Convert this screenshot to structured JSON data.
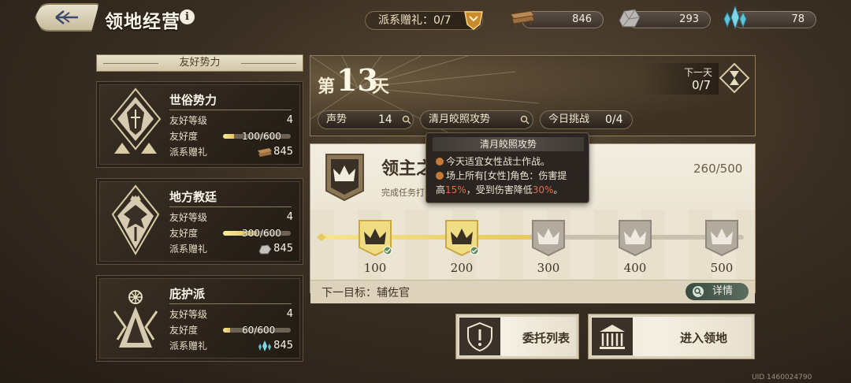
{
  "header": {
    "title": "领地经营",
    "gift_label": "派系赠礼：0/7",
    "resources": [
      {
        "name": "wood-plank",
        "value": "846"
      },
      {
        "name": "stone-ore",
        "value": "293"
      },
      {
        "name": "blue-crystal",
        "value": "78"
      }
    ]
  },
  "left_panel": {
    "section_title": "友好势力",
    "factions": [
      {
        "name": "世俗势力",
        "level_label": "友好等级",
        "level": "4",
        "fav_label": "友好度",
        "fav_text": "100/600",
        "fav_fraction": 0.167,
        "gift_label": "派系赠礼",
        "gift_value": "845",
        "gift_icon": "wood-plank"
      },
      {
        "name": "地方教廷",
        "level_label": "友好等级",
        "level": "4",
        "fav_label": "友好度",
        "fav_text": "300/600",
        "fav_fraction": 0.5,
        "gift_label": "派系赠礼",
        "gift_value": "845",
        "gift_icon": "stone-ore"
      },
      {
        "name": "庇护派",
        "level_label": "友好等级",
        "level": "4",
        "fav_label": "友好度",
        "fav_text": "60/600",
        "fav_fraction": 0.1,
        "gift_label": "派系赠礼",
        "gift_value": "845",
        "gift_icon": "blue-crystal"
      }
    ]
  },
  "day": {
    "prefix": "第",
    "number": "13",
    "suffix": "天",
    "next_day_label": "下一天",
    "next_day_value": "0/7"
  },
  "stats": {
    "prestige_label": "声势",
    "prestige_value": "14",
    "event_label": "清月皎照攻势",
    "challenge_label": "今日挑战",
    "challenge_value": "0/4"
  },
  "tooltip": {
    "title": "清月皎照攻势",
    "line1": "今天适宜女性战士作战。",
    "line2": "场上所有[女性]角色：伤害提",
    "line3_a": "高",
    "line3_b": "15%",
    "line3_c": "，受到伤害降低",
    "line3_d": "30%",
    "line3_e": "。"
  },
  "lord": {
    "title": "领主之",
    "subtitle": "完成任务打",
    "score": "260/500",
    "progress_fraction": 0.52,
    "milestones": [
      {
        "value": "100",
        "reached": true
      },
      {
        "value": "200",
        "reached": true
      },
      {
        "value": "300",
        "reached": false
      },
      {
        "value": "400",
        "reached": false
      },
      {
        "value": "500",
        "reached": false
      }
    ],
    "next_target": "下一目标：辅佐官",
    "detail_label": "详情"
  },
  "buttons": {
    "commission": "委托列表",
    "enter": "进入领地"
  },
  "uid": "UID 1460024790"
}
